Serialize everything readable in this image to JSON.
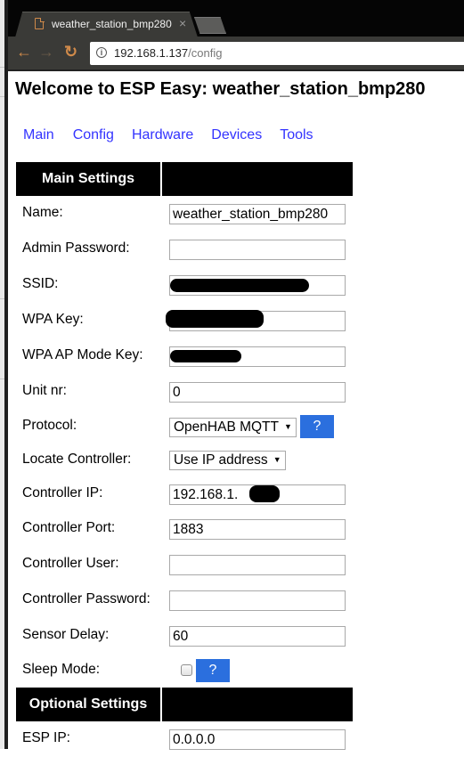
{
  "browser": {
    "tab_title": "weather_station_bmp280",
    "tab_close_glyph": "×",
    "url_host": "192.168.1.137",
    "url_path": "/config",
    "icons": {
      "page": "page-icon",
      "back": "←",
      "forward": "→",
      "reload": "C",
      "info": "i"
    }
  },
  "page": {
    "title": "Welcome to ESP Easy: weather_station_bmp280",
    "menu": [
      "Main",
      "Config",
      "Hardware",
      "Devices",
      "Tools"
    ],
    "link_color": "#3333ff",
    "help_button_color": "#2b6fde"
  },
  "main_settings": {
    "header": "Main Settings",
    "fields": {
      "name": {
        "label": "Name:",
        "value": "weather_station_bmp280"
      },
      "admin_password": {
        "label": "Admin Password:",
        "value": ""
      },
      "ssid": {
        "label": "SSID:",
        "value": "[redacted]"
      },
      "wpa_key": {
        "label": "WPA Key:",
        "value": "[redacted]"
      },
      "wpa_ap_key": {
        "label": "WPA AP Mode Key:",
        "value": "[redacted]"
      },
      "unit_nr": {
        "label": "Unit nr:",
        "value": "0"
      },
      "protocol": {
        "label": "Protocol:",
        "value": "OpenHAB MQTT",
        "help": "?"
      },
      "locate_controller": {
        "label": "Locate Controller:",
        "value": "Use IP address"
      },
      "controller_ip": {
        "label": "Controller IP:",
        "value": "192.168.1."
      },
      "controller_port": {
        "label": "Controller Port:",
        "value": "1883"
      },
      "controller_user": {
        "label": "Controller User:",
        "value": ""
      },
      "controller_password": {
        "label": "Controller Password:",
        "value": ""
      },
      "sensor_delay": {
        "label": "Sensor Delay:",
        "value": "60"
      },
      "sleep_mode": {
        "label": "Sleep Mode:",
        "checked": false,
        "help": "?"
      }
    }
  },
  "optional_settings": {
    "header": "Optional Settings",
    "fields": {
      "esp_ip": {
        "label": "ESP IP:",
        "value": "0.0.0.0"
      }
    }
  }
}
